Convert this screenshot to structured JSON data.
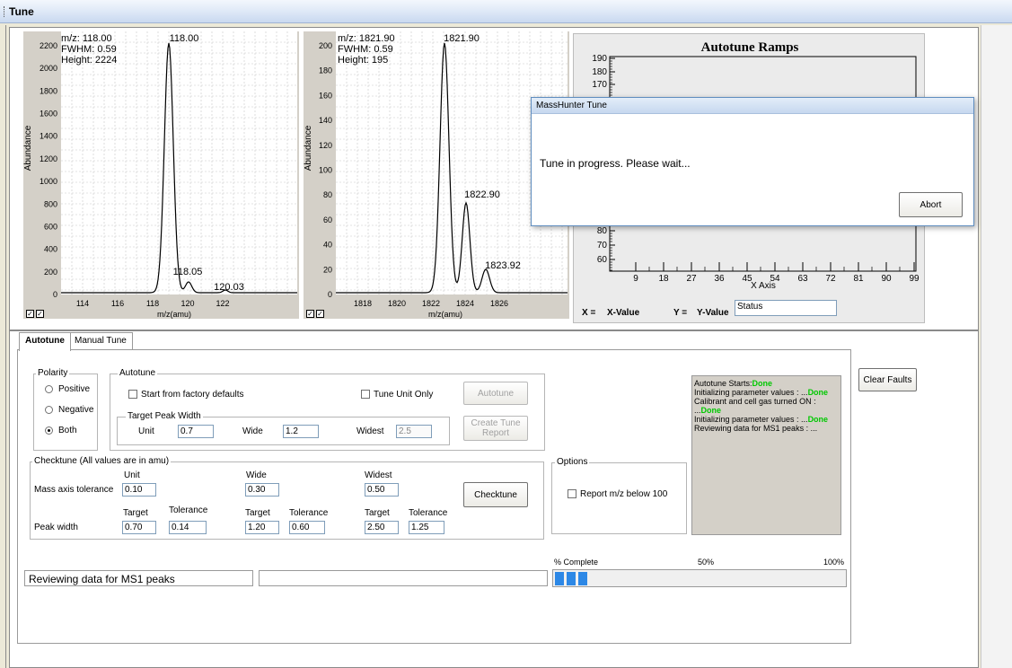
{
  "window": {
    "title": "Tune"
  },
  "spectrum1": {
    "info": [
      "m/z: 118.00",
      "FWHM: 0.59",
      "Height: 2224"
    ],
    "ylabel": "Abundance",
    "xlabel": "m/z(amu)",
    "y_ticks": [
      "0",
      "200",
      "400",
      "600",
      "800",
      "1000",
      "1200",
      "1400",
      "1600",
      "1800",
      "2000",
      "2200"
    ],
    "x_ticks": [
      "114",
      "116",
      "118",
      "120",
      "122"
    ],
    "peak_labels": [
      "118.00",
      "118.05",
      "120.03"
    ]
  },
  "spectrum2": {
    "info": [
      "m/z: 1821.90",
      "FWHM: 0.59",
      "Height: 195"
    ],
    "ylabel": "Abundance",
    "xlabel": "m/z(amu)",
    "y_ticks": [
      "0",
      "20",
      "40",
      "60",
      "80",
      "100",
      "120",
      "140",
      "160",
      "180",
      "200"
    ],
    "x_ticks": [
      "1818",
      "1820",
      "1822",
      "1824",
      "1826"
    ],
    "peak_labels": [
      "1821.90",
      "1822.90",
      "1823.92"
    ]
  },
  "ramps": {
    "title": "Autotune Ramps",
    "xlabel": "X Axis",
    "y_ticks": [
      "60",
      "70",
      "80",
      "170",
      "180",
      "190"
    ],
    "x_ticks": [
      "9",
      "18",
      "27",
      "36",
      "45",
      "54",
      "63",
      "72",
      "81",
      "90",
      "99"
    ],
    "x_label": "X =",
    "x_value": "X-Value",
    "y_label": "Y =",
    "y_value": "Y-Value",
    "status": "Status"
  },
  "dialog": {
    "title": "MassHunter Tune",
    "message": "Tune in progress. Please wait...",
    "abort": "Abort"
  },
  "tabs": [
    "Autotune",
    "Manual Tune"
  ],
  "polarity": {
    "legend": "Polarity",
    "options": [
      "Positive",
      "Negative",
      "Both"
    ],
    "selected": "Both"
  },
  "autotune": {
    "legend": "Autotune",
    "start_factory": "Start from factory defaults",
    "tune_unit_only": "Tune Unit Only",
    "autotune_btn": "Autotune",
    "create_report_btn": "Create Tune Report",
    "target_peak_width": "Target Peak Width",
    "unit_label": "Unit",
    "unit_value": "0.7",
    "wide_label": "Wide",
    "wide_value": "1.2",
    "widest_label": "Widest",
    "widest_value": "2.5"
  },
  "checktune": {
    "legend": "Checktune  (All values are in amu)",
    "col_unit": "Unit",
    "col_wide": "Wide",
    "col_widest": "Widest",
    "mass_axis_label": "Mass axis tolerance",
    "mass_axis_values": [
      "0.10",
      "0.30",
      "0.50"
    ],
    "target": "Target",
    "tolerance": "Tolerance",
    "peak_width_label": "Peak width",
    "peak_width_values": [
      "0.70",
      "0.14",
      "1.20",
      "0.60",
      "2.50",
      "1.25"
    ],
    "checktune_btn": "Checktune"
  },
  "options": {
    "legend": "Options",
    "report_below": "Report m/z below 100"
  },
  "clear_faults": "Clear Faults",
  "log": [
    {
      "text": "Autotune Starts:",
      "status": "Done"
    },
    {
      "text": "Initializing parameter values  : ...",
      "status": "Done"
    },
    {
      "text": "Calibrant and cell gas turned ON  :",
      "status": ""
    },
    {
      "text": "...",
      "status": "Done"
    },
    {
      "text": "Initializing parameter values  : ...",
      "status": "Done"
    },
    {
      "text": "Reviewing data for MS1 peaks  : ...",
      "status": ""
    }
  ],
  "status_text": "Reviewing data for MS1 peaks",
  "progress": {
    "label": "% Complete",
    "mid": "50%",
    "end": "100%",
    "segments": 3
  }
}
